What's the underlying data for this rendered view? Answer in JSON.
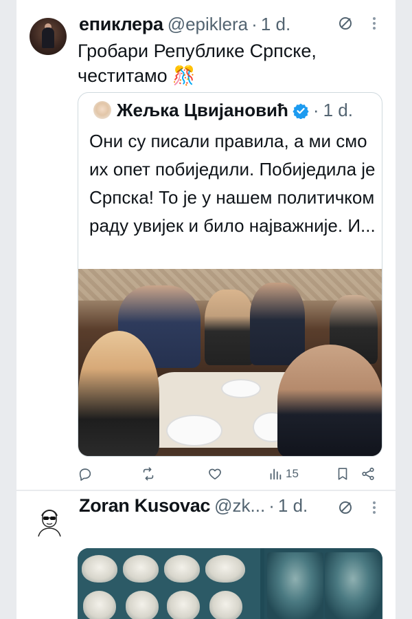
{
  "tweet1": {
    "author_name": "епиклера",
    "handle": "@epiklera",
    "separator": "·",
    "time": "1 d.",
    "avatar": "user-avatar-photo",
    "text": "Гробари Републике Српске, честитамо 🎊",
    "quote": {
      "author_name": "Жељка Цвијановић",
      "verified": true,
      "separator": "·",
      "time": "1 d.",
      "text": "Они су писали правила, а ми смо их опет побиједили. Побиједила је Српска! То је у нашем политичком раду увијек и било најважније. И...",
      "media": "group-selfie-photo"
    },
    "actions": {
      "reply_count": "",
      "retweet_count": "",
      "like_count": "",
      "views_count": "15"
    }
  },
  "tweet2": {
    "author_name": "Zoran Kusovac",
    "handle": "@zk...",
    "separator": "·",
    "time": "1 d.",
    "avatar": "cartoon-avatar",
    "media": "skulls-and-portraits-image"
  },
  "colors": {
    "text_primary": "#0f1419",
    "text_secondary": "#536471",
    "verified": "#1d9bf0",
    "border": "#cfd9de",
    "page_bg": "#e9ebee"
  }
}
